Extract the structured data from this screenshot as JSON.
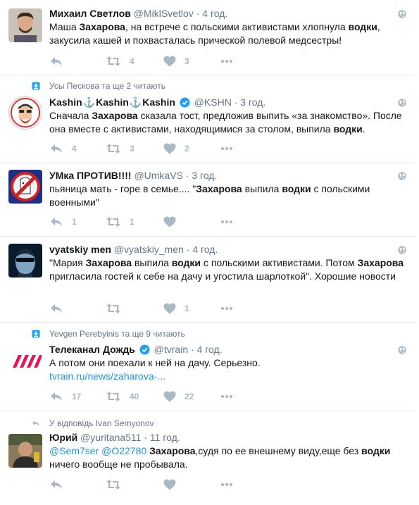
{
  "colors": {
    "text": "#14171a",
    "meta": "#657786",
    "link": "#1b95e0",
    "icon": "#aab8c2",
    "divider": "#e1e8ed",
    "verified": "#1da1f2"
  },
  "tweets": [
    {
      "name": "Михаил Светлов",
      "handle": "@MiklSvetlov",
      "sep": "·",
      "time": "4 год.",
      "text": [
        "Маша ",
        "Захарова",
        ", на встрече с польскими активистами хлопнула ",
        "водки",
        ", закусила кашей и похвасталась прической полевой медсестры!"
      ],
      "reply": "",
      "retweets": "4",
      "likes": "3"
    },
    {
      "context": "Усы Пескова та ще 2 читають",
      "name_parts": [
        "Kashin",
        "⚓",
        "Kashin",
        "⚓",
        "Kashin"
      ],
      "handle": "@KSHN",
      "sep": "·",
      "time": "3 год.",
      "text": [
        "Сначала ",
        "Захарова",
        " сказала тост, предложив выпить «за знакомство». После она вместе с активистами, находящимися за столом, выпила ",
        "водки",
        "."
      ],
      "reply": "4",
      "retweets": "3",
      "likes": "2"
    },
    {
      "name": "УМка ПРОТИВ!!!!",
      "handle": "@UmkaVS",
      "sep": "·",
      "time": "3 год.",
      "text": [
        "пьяница мать - горе в семье.... \"",
        "Захарова",
        " выпила ",
        "водки",
        " с польскими военными\""
      ],
      "reply": "1",
      "retweets": "1",
      "likes": ""
    },
    {
      "name": "vyatskiy men",
      "handle": "@vyatskiy_men",
      "sep": "·",
      "time": "4 год.",
      "text": [
        "\"Мария ",
        "Захарова",
        " выпила ",
        "водки",
        " с польскими активистами. Потом ",
        "Захарова",
        " пригласила гостей к себе на дачу и угостила шарлоткой\". Хорошие новости"
      ],
      "reply": "",
      "retweets": "",
      "likes": "1"
    },
    {
      "context": "Yevgen Perebyinis та ще 9 читають",
      "name": "Телеканал Дождь",
      "handle": "@tvrain",
      "sep": "·",
      "time": "4 год.",
      "text_plain": "А потом они поехали к ней на дачу. Серьезно.",
      "link": "tvrain.ru/news/zaharova-...",
      "reply": "17",
      "retweets": "40",
      "likes": "22"
    },
    {
      "context": "У відповідь Ivan Semyonov",
      "name": "Юрий",
      "handle": "@yuritana511",
      "sep": "·",
      "time": "11 год.",
      "mentions": [
        "@Sem7ser",
        "@O22780"
      ],
      "text": [
        " ",
        "Захарова",
        ",судя по ее внешнему виду,еще без ",
        "водки",
        " ничего вообще не пробывала."
      ],
      "reply": "",
      "retweets": "",
      "likes": ""
    }
  ]
}
